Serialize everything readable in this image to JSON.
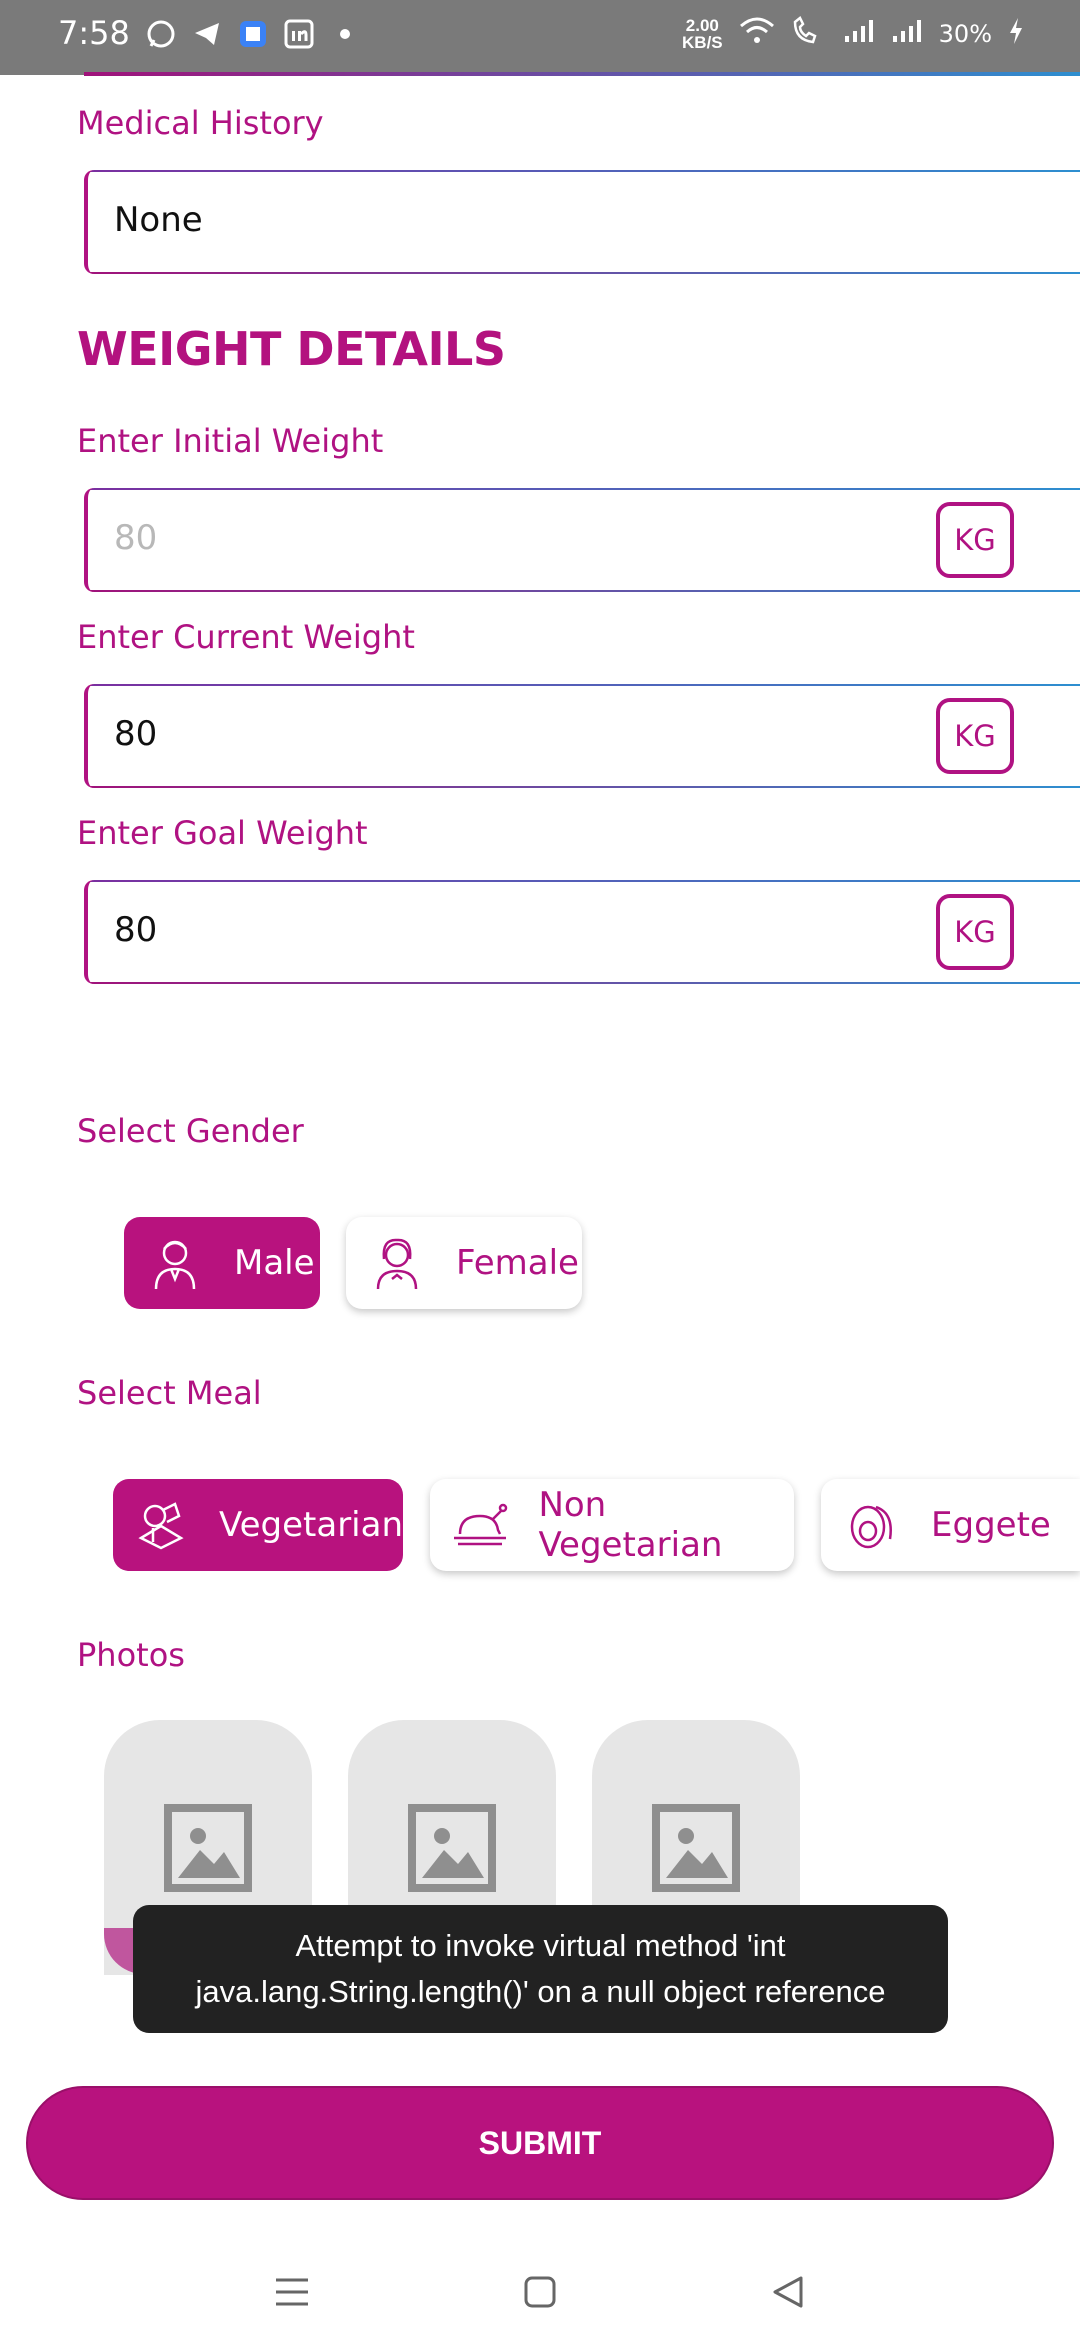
{
  "status_bar": {
    "time": "7:58",
    "net_speed_value": "2.00",
    "net_speed_unit": "KB/S",
    "battery": "30%",
    "icons": [
      "whatsapp-icon",
      "telegram-icon",
      "app-icon",
      "linkedin-icon",
      "dot-icon",
      "wifi-icon",
      "volte-call-icon",
      "signal-icon",
      "signal-icon",
      "charging-icon"
    ]
  },
  "medical_history": {
    "label": "Medical History",
    "value": "None"
  },
  "weight_details": {
    "title": "WEIGHT DETAILS",
    "initial": {
      "label": "Enter Initial Weight",
      "placeholder": "80",
      "unit": "KG"
    },
    "current": {
      "label": "Enter Current Weight",
      "value": "80",
      "unit": "KG"
    },
    "goal": {
      "label": "Enter Goal Weight",
      "value": "80",
      "unit": "KG"
    }
  },
  "gender": {
    "label": "Select Gender",
    "options": [
      {
        "label": "Male",
        "selected": true,
        "icon": "male-avatar-icon"
      },
      {
        "label": "Female",
        "selected": false,
        "icon": "female-avatar-icon"
      }
    ]
  },
  "meal": {
    "label": "Select Meal",
    "options": [
      {
        "label": "Vegetarian",
        "selected": true,
        "icon": "vegetables-icon"
      },
      {
        "label": "Non Vegetarian",
        "selected": false,
        "icon": "roast-chicken-icon"
      },
      {
        "label": "Eggete",
        "selected": false,
        "icon": "egg-icon"
      }
    ]
  },
  "photos": {
    "label": "Photos",
    "count": 3
  },
  "toast": {
    "message": "Attempt to invoke virtual method 'int java.lang.String.length()' on a null object reference"
  },
  "submit": {
    "label": "SUBMIT"
  },
  "colors": {
    "accent": "#b8127e",
    "status_bar": "#7a7a7a",
    "toast_bg": "#222222"
  }
}
